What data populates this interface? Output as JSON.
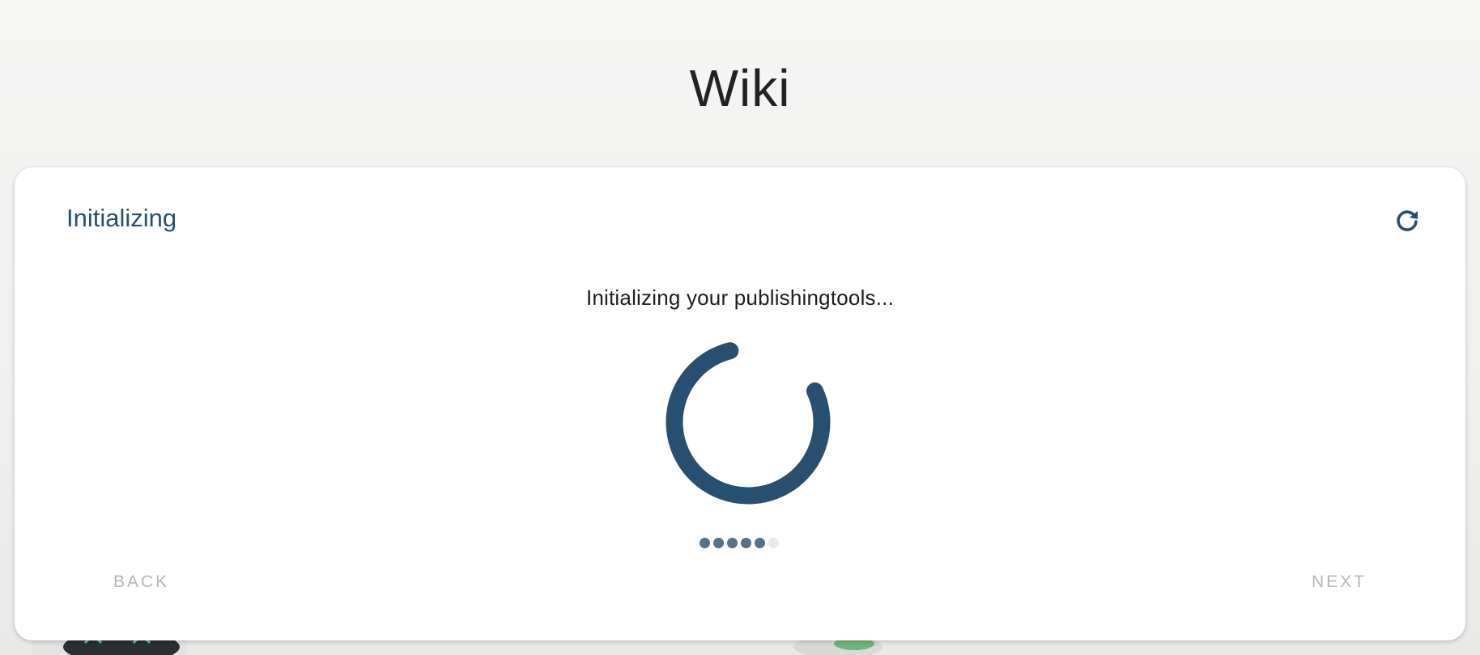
{
  "page": {
    "title": "Wiki"
  },
  "card": {
    "title": "Initializing",
    "refresh_icon": "refresh-icon",
    "message": "Initializing your publishingtools...",
    "progress": {
      "completed_steps": 5,
      "total_steps": 6
    },
    "back_label": "BACK",
    "next_label": "NEXT"
  },
  "colors": {
    "accent": "#28506f",
    "spinner": "#274f70",
    "dot_done": "#56718a",
    "dot_pending": "#e6eaee",
    "disabled_text": "#b5b5b5"
  }
}
